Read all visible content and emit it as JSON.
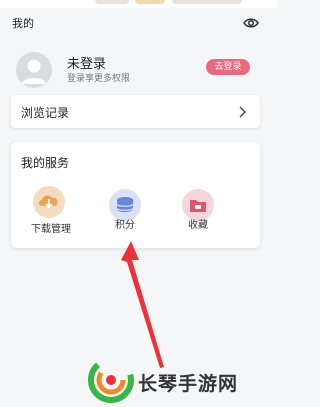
{
  "header": {
    "title": "我的",
    "visibility_icon": "eye-icon"
  },
  "profile": {
    "name": "未登录",
    "subtitle": "登录享更多权限",
    "login_button": "去登录",
    "avatar_icon": "user-avatar-icon"
  },
  "history": {
    "label": "浏览记录",
    "chevron_icon": "chevron-right-icon"
  },
  "services": {
    "title": "我的服务",
    "items": [
      {
        "label": "下载管理",
        "icon": "download-cloud-icon",
        "color": "#e6b36a"
      },
      {
        "label": "积分",
        "icon": "coin-stack-icon",
        "color": "#6b86d6"
      },
      {
        "label": "收藏",
        "icon": "folder-star-icon",
        "color": "#e0566a"
      }
    ]
  },
  "watermark": {
    "text": "长琴手游网"
  },
  "colors": {
    "accent_pink": "#e96a80",
    "arrow_red": "#e8343a",
    "background": "#f5f6f8"
  }
}
